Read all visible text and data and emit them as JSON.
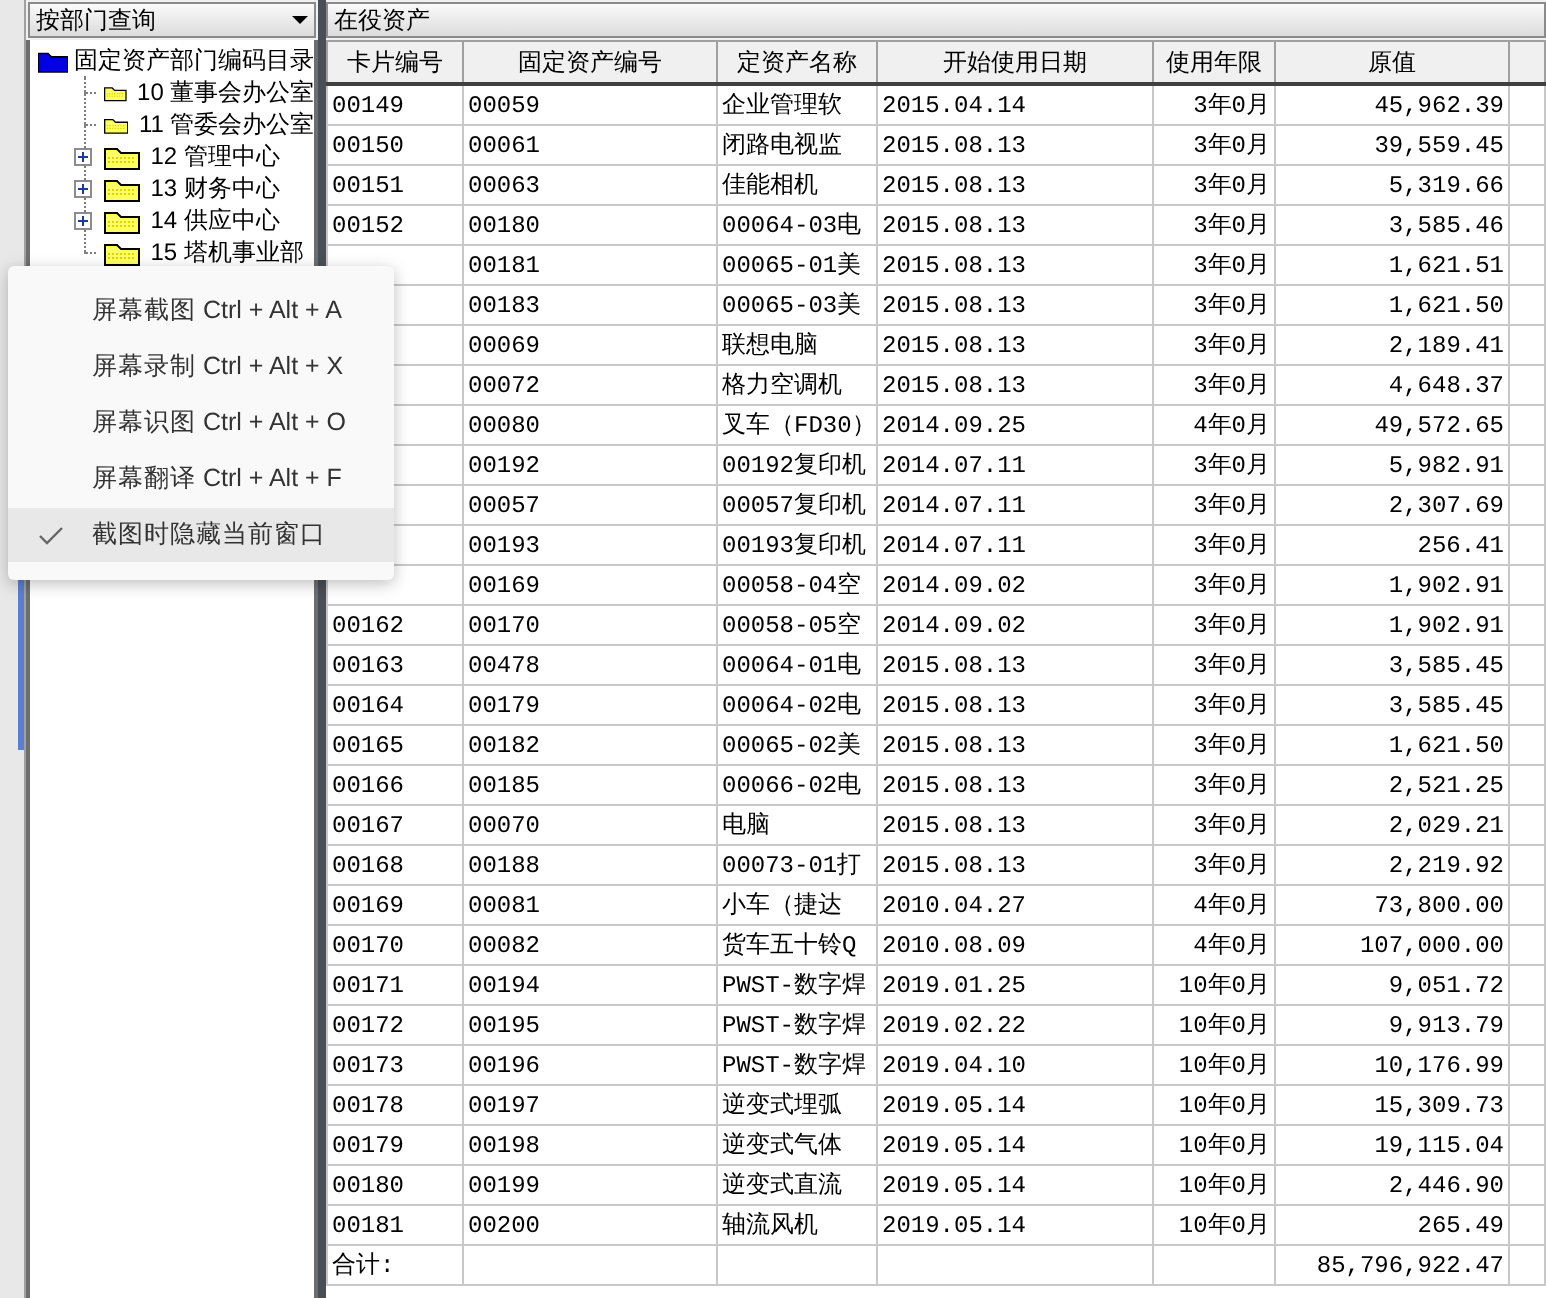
{
  "query_dropdown": {
    "value": "按部门查询"
  },
  "tree": {
    "label": "固定资产部门编码目录",
    "expanded": true,
    "children": [
      {
        "label": "10 董事会办公室",
        "expandable": false
      },
      {
        "label": "11 管委会办公室",
        "expandable": false
      },
      {
        "label": "12 管理中心",
        "expandable": true
      },
      {
        "label": "13 财务中心",
        "expandable": true
      },
      {
        "label": "14 供应中心",
        "expandable": true
      },
      {
        "label": "15 塔机事业部",
        "expandable": false
      }
    ]
  },
  "panel_title": "在役资产",
  "table": {
    "columns": [
      "卡片编号",
      "固定资产编号",
      "定资产名称",
      "开始使用日期",
      "使用年限",
      "原值"
    ],
    "rows": [
      {
        "cells": [
          "00149",
          "00059",
          "企业管理软",
          "2015.04.14",
          "3年0月",
          "45,962.39"
        ]
      },
      {
        "cells": [
          "00150",
          "00061",
          "闭路电视监",
          "2015.08.13",
          "3年0月",
          "39,559.45"
        ]
      },
      {
        "cells": [
          "00151",
          "00063",
          "佳能相机",
          "2015.08.13",
          "3年0月",
          "5,319.66"
        ]
      },
      {
        "cells": [
          "00152",
          "00180",
          "00064-03电",
          "2015.08.13",
          "3年0月",
          "3,585.46"
        ]
      },
      {
        "cells": [
          null,
          "00181",
          "00065-01美",
          "2015.08.13",
          "3年0月",
          "1,621.51"
        ]
      },
      {
        "cells": [
          null,
          "00183",
          "00065-03美",
          "2015.08.13",
          "3年0月",
          "1,621.50"
        ]
      },
      {
        "cells": [
          null,
          "00069",
          "联想电脑",
          "2015.08.13",
          "3年0月",
          "2,189.41"
        ]
      },
      {
        "cells": [
          null,
          "00072",
          "格力空调机",
          "2015.08.13",
          "3年0月",
          "4,648.37"
        ]
      },
      {
        "cells": [
          null,
          "00080",
          "叉车（FD30）",
          "2014.09.25",
          "4年0月",
          "49,572.65"
        ]
      },
      {
        "cells": [
          null,
          "00192",
          "00192复印机",
          "2014.07.11",
          "3年0月",
          "5,982.91"
        ]
      },
      {
        "cells": [
          null,
          "00057",
          "00057复印机",
          "2014.07.11",
          "3年0月",
          "2,307.69"
        ]
      },
      {
        "cells": [
          null,
          "00193",
          "00193复印机",
          "2014.07.11",
          "3年0月",
          "256.41"
        ]
      },
      {
        "cells": [
          null,
          "00169",
          "00058-04空",
          "2014.09.02",
          "3年0月",
          "1,902.91"
        ]
      },
      {
        "cells": [
          "00162",
          "00170",
          "00058-05空",
          "2014.09.02",
          "3年0月",
          "1,902.91"
        ]
      },
      {
        "cells": [
          "00163",
          "00478",
          "00064-01电",
          "2015.08.13",
          "3年0月",
          "3,585.45"
        ]
      },
      {
        "cells": [
          "00164",
          "00179",
          "00064-02电",
          "2015.08.13",
          "3年0月",
          "3,585.45"
        ]
      },
      {
        "cells": [
          "00165",
          "00182",
          "00065-02美",
          "2015.08.13",
          "3年0月",
          "1,621.50"
        ]
      },
      {
        "cells": [
          "00166",
          "00185",
          "00066-02电",
          "2015.08.13",
          "3年0月",
          "2,521.25"
        ]
      },
      {
        "cells": [
          "00167",
          "00070",
          "电脑",
          "2015.08.13",
          "3年0月",
          "2,029.21"
        ]
      },
      {
        "cells": [
          "00168",
          "00188",
          "00073-01打",
          "2015.08.13",
          "3年0月",
          "2,219.92"
        ]
      },
      {
        "cells": [
          "00169",
          "00081",
          "小车（捷达",
          "2010.04.27",
          "4年0月",
          "73,800.00"
        ]
      },
      {
        "cells": [
          "00170",
          "00082",
          "货车五十铃Q",
          "2010.08.09",
          "4年0月",
          "107,000.00"
        ]
      },
      {
        "cells": [
          "00171",
          "00194",
          "PWST-数字焊",
          "2019.01.25",
          "10年0月",
          "9,051.72"
        ]
      },
      {
        "cells": [
          "00172",
          "00195",
          "PWST-数字焊",
          "2019.02.22",
          "10年0月",
          "9,913.79"
        ]
      },
      {
        "cells": [
          "00173",
          "00196",
          "PWST-数字焊",
          "2019.04.10",
          "10年0月",
          "10,176.99"
        ]
      },
      {
        "cells": [
          "00178",
          "00197",
          "逆变式埋弧",
          "2019.05.14",
          "10年0月",
          "15,309.73"
        ]
      },
      {
        "cells": [
          "00179",
          "00198",
          "逆变式气体",
          "2019.05.14",
          "10年0月",
          "19,115.04"
        ]
      },
      {
        "cells": [
          "00180",
          "00199",
          "逆变式直流",
          "2019.05.14",
          "10年0月",
          "2,446.90"
        ]
      },
      {
        "cells": [
          "00181",
          "00200",
          "轴流风机",
          "2019.05.14",
          "10年0月",
          "265.49"
        ]
      }
    ],
    "total": {
      "label": "合计:",
      "value": "85,796,922.47"
    }
  },
  "context_menu": {
    "items": [
      {
        "label": "屏幕截图 Ctrl + Alt + A",
        "checked": false,
        "selected": false
      },
      {
        "label": "屏幕录制 Ctrl + Alt + X",
        "checked": false,
        "selected": false
      },
      {
        "label": "屏幕识图 Ctrl + Alt + O",
        "checked": false,
        "selected": false
      },
      {
        "label": "屏幕翻译 Ctrl + Alt + F",
        "checked": false,
        "selected": false
      },
      {
        "label": "截图时隐藏当前窗口",
        "checked": true,
        "selected": true
      }
    ]
  }
}
